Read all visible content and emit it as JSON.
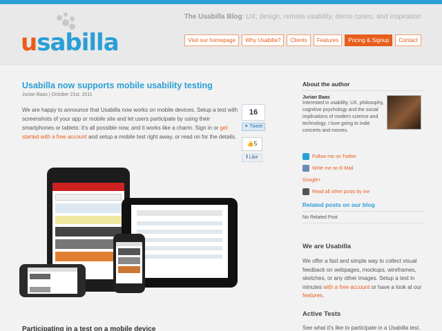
{
  "header": {
    "logo_text": "usabilla",
    "tagline_brand": "The Usabilla Blog",
    "tagline_rest": ": UX, design, remote usability, demo cases, and inspiration"
  },
  "nav": [
    {
      "label": "Visit our homepage",
      "active": false
    },
    {
      "label": "Why Usabilla?",
      "active": false
    },
    {
      "label": "Clients",
      "active": false
    },
    {
      "label": "Features",
      "active": false
    },
    {
      "label": "Pricing & Signup",
      "active": true
    },
    {
      "label": "Contact",
      "active": false
    }
  ],
  "post": {
    "title": "Usabilla now supports mobile usability testing",
    "meta": "Jurian Baas | October 21st, 2011",
    "body_1": "We are happy to announce that Usabilla now works on mobile devices. Setup a test with screenshots of your app or mobile site and let users participate by using their smartphones or tablets: it's all possible now, and it works like a charm. Sign in or ",
    "body_link": "get started with a free account",
    "body_2": " and setup a mobile test right away, or read on for the details.",
    "next_heading": "Participating in a test on a mobile device"
  },
  "share": {
    "tweet_count": "16",
    "tweet_label": "Tweet",
    "like_count": "5",
    "like_label": "Like"
  },
  "sidebar": {
    "about_heading": "About the author",
    "author_name": "Jurian Baas",
    "author_bio": "Interested in usability, UX, philosophy, cognitive psychology and the social implications of modern science and technology. I love going to indie concerts and movies.",
    "links": [
      {
        "label": "Follow me on Twitter",
        "icon": "twitter-icon",
        "color": "#2a9fd6"
      },
      {
        "label": "Write me on E-Mail",
        "icon": "mail-icon",
        "color": "#6a8ab0"
      },
      {
        "label": "Google+",
        "icon": "",
        "color": ""
      },
      {
        "label": "Read all other posts by me",
        "icon": "posts-icon",
        "color": "#555555"
      }
    ],
    "related_heading": "Related posts on our blog",
    "related_none": "No Related Post",
    "we_heading": "We are Usabilla",
    "we_text_1": "We offer a fast and simple way to collect visual feedback on webpages, mockups, wireframes, sketches, or any other images. Setup a test in minutes ",
    "we_link_1": "with a free account",
    "we_text_2": " or have a look at our ",
    "we_link_2": "features",
    "we_text_3": ".",
    "active_heading": "Active Tests",
    "active_text": "See what it's like to participate in a Usabilla test."
  },
  "colors": {
    "brand_blue": "#2a9fd6",
    "brand_orange": "#e85d1a"
  }
}
